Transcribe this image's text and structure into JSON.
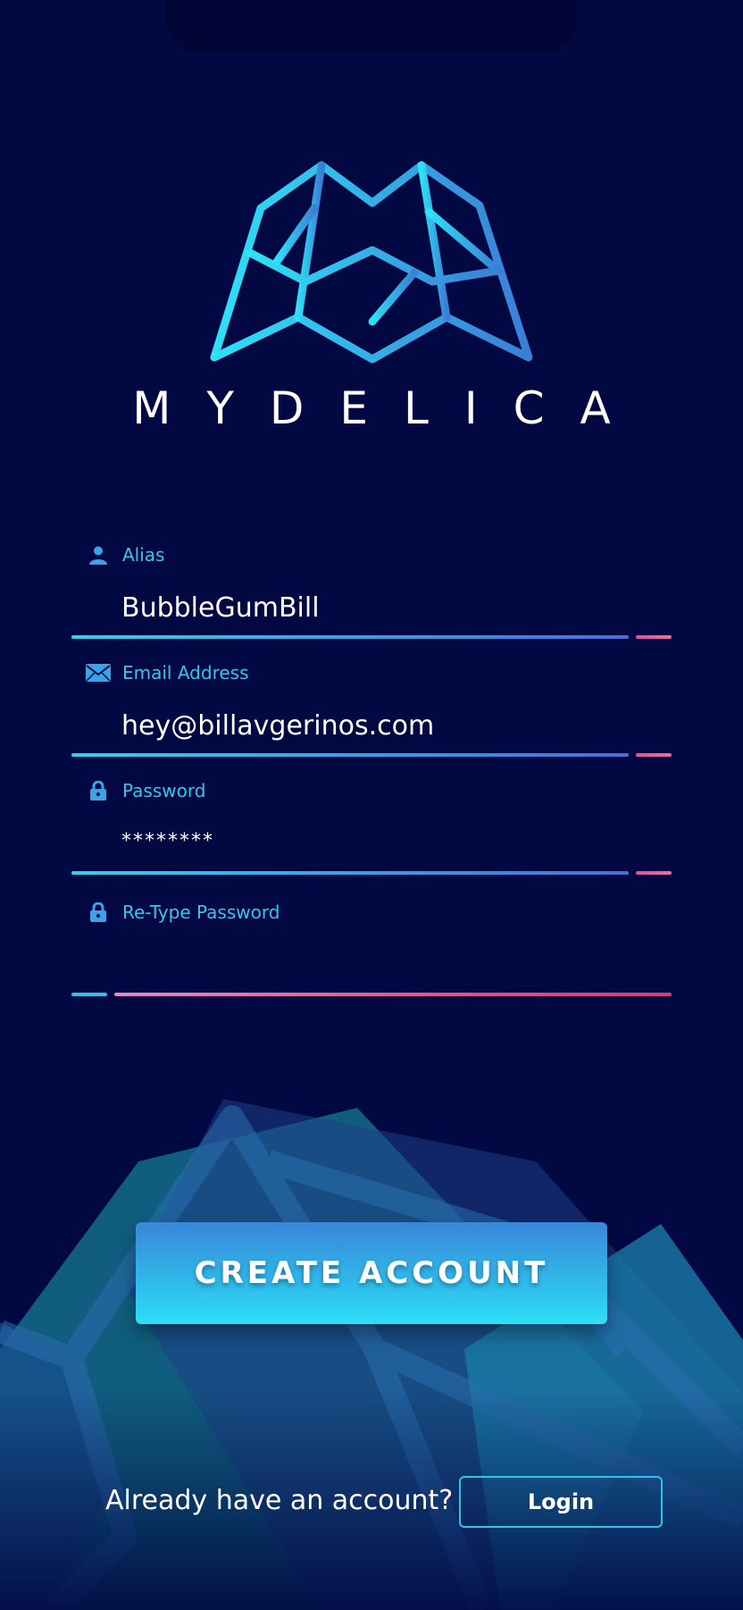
{
  "app": {
    "brand": "MYDELICA"
  },
  "colors": {
    "background": "#010842",
    "accent_cyan": "#2ec9ee",
    "accent_blue": "#3a87d8",
    "accent_pink": "#e25593"
  },
  "form": {
    "alias": {
      "label": "Alias",
      "value": "BubbleGumBill",
      "icon": "user-icon"
    },
    "email": {
      "label": "Email Address",
      "value": "hey@billavgerinos.com",
      "icon": "envelope-icon"
    },
    "password": {
      "label": "Password",
      "value": "********",
      "icon": "lock-icon"
    },
    "retype_password": {
      "label": "Re-Type Password",
      "value": "",
      "icon": "lock-icon"
    }
  },
  "actions": {
    "create_account": "CREATE ACCOUNT",
    "already_text": "Already have an account?",
    "login": "Login"
  }
}
